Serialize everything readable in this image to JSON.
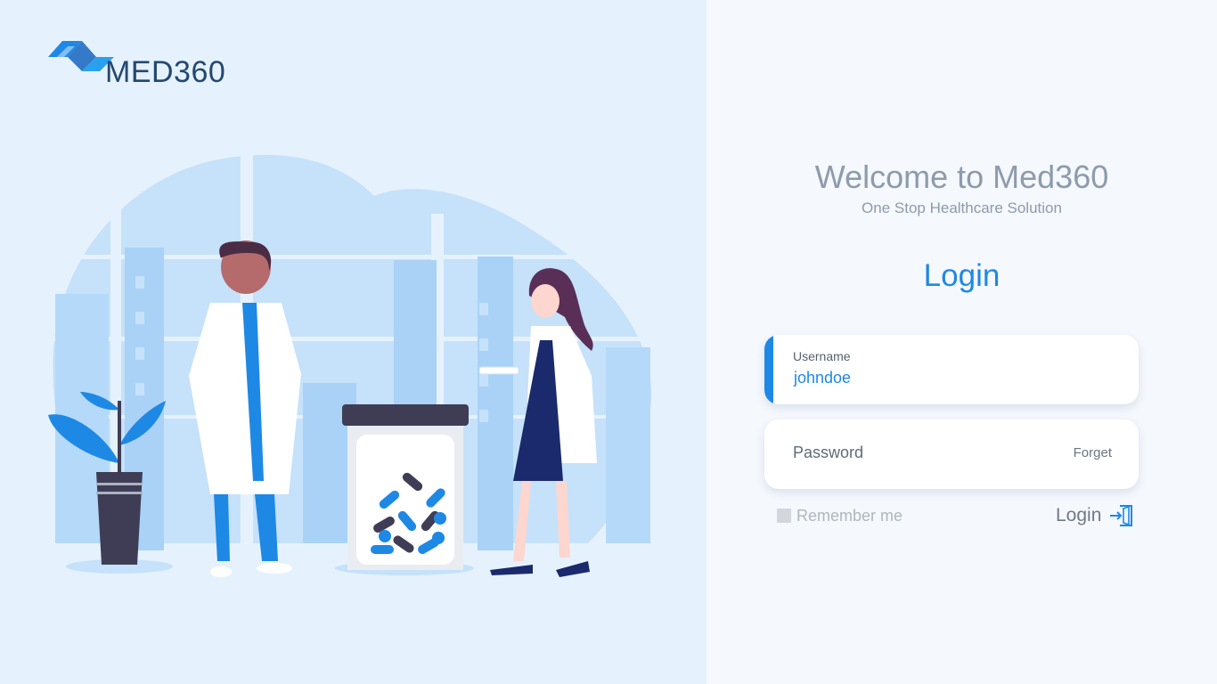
{
  "brand": {
    "name": "MED360"
  },
  "welcome": {
    "title": "Welcome to Med360",
    "subtitle": "One Stop Healthcare Solution"
  },
  "login_form": {
    "heading": "Login",
    "username": {
      "label": "Username",
      "value": "johndoe"
    },
    "password": {
      "placeholder": "Password",
      "forget_label": "Forget"
    },
    "remember_label": "Remember me",
    "submit_label": "Login"
  },
  "colors": {
    "accent": "#1e88e5",
    "brand_dark": "#24486f",
    "left_bg": "#e5f2fd",
    "right_bg": "#f5f8fd",
    "muted_text": "#8d9bac"
  },
  "icons": {
    "logo": "med360-logo-mark",
    "submit": "door-enter-icon"
  }
}
